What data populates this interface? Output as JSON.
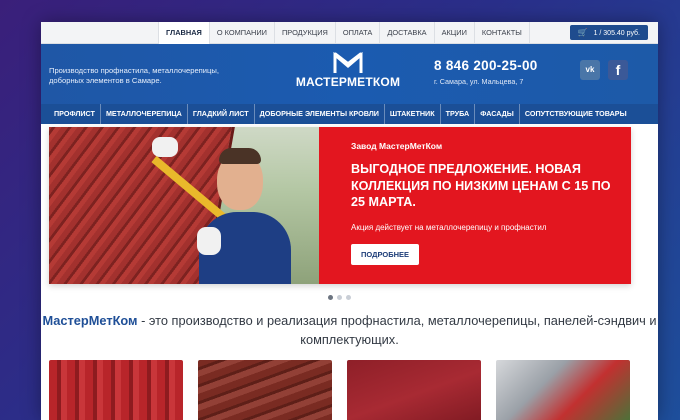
{
  "topnav": {
    "items": [
      "ГЛАВНАЯ",
      "О КОМПАНИИ",
      "ПРОДУКЦИЯ",
      "ОПЛАТА",
      "ДОСТАВКА",
      "АКЦИИ",
      "КОНТАКТЫ"
    ],
    "active": "ГЛАВНАЯ"
  },
  "cart": {
    "icon": "cart-icon",
    "label": "1 / 305.40 руб."
  },
  "header": {
    "tagline": "Производство профнастила, металлочерепицы, доборных элементов в Самаре.",
    "logo_text": "МАСТЕРМЕТКОМ",
    "phone": "8 846 200-25-00",
    "address": "г. Самара, ул. Мальцева, 7",
    "social": {
      "vk": "vk",
      "fb": "f"
    }
  },
  "mainnav": {
    "items": [
      "ПРОФЛИСТ",
      "МЕТАЛЛОЧЕРЕПИЦА",
      "ГЛАДКИЙ ЛИСТ",
      "ДОБОРНЫЕ ЭЛЕМЕНТЫ КРОВЛИ",
      "ШТАКЕТНИК",
      "ТРУБА",
      "ФАСАДЫ",
      "СОПУТСТВУЮЩИЕ ТОВАРЫ"
    ]
  },
  "banner": {
    "kicker": "Завод МастерМетКом",
    "title": "Выгодное предложение. Новая коллекция по низким ценам с 15 по 25 марта.",
    "subtitle": "Акция действует на металлочерепицу и профнастил",
    "button": "ПОДРОБНЕЕ",
    "slides": 3,
    "active_slide": 1
  },
  "intro": {
    "brand": "МастерМетКом",
    "text": " - это производство и реализация профнастила, металлочерепицы, панелей-сэндвич и комплектующих."
  },
  "colors": {
    "header_blue": "#1b5bb0",
    "nav_blue": "#1b4f97",
    "banner_red": "#e3161f",
    "brand_text": "#1f4f97"
  }
}
